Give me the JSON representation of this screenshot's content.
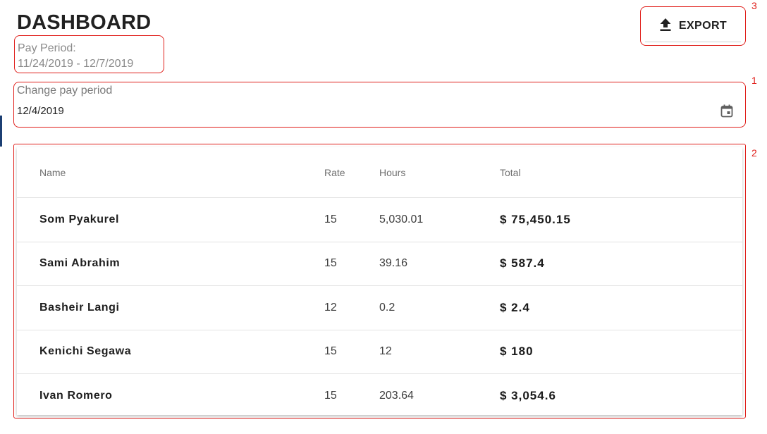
{
  "header": {
    "title": "DASHBOARD",
    "pay_period_label": "Pay Period:",
    "pay_period_range": "11/24/2019 - 12/7/2019",
    "export_label": "EXPORT"
  },
  "date_picker": {
    "label": "Change pay period",
    "value": "12/4/2019"
  },
  "callouts": [
    "1",
    "2",
    "3"
  ],
  "table": {
    "columns": [
      "Name",
      "Rate",
      "Hours",
      "Total"
    ],
    "rows": [
      {
        "name": "Som Pyakurel",
        "rate": "15",
        "hours": "5,030.01",
        "total": "$ 75,450.15"
      },
      {
        "name": "Sami Abrahim",
        "rate": "15",
        "hours": "39.16",
        "total": "$ 587.4"
      },
      {
        "name": "Basheir Langi",
        "rate": "12",
        "hours": "0.2",
        "total": "$ 2.4"
      },
      {
        "name": "Kenichi Segawa",
        "rate": "15",
        "hours": "12",
        "total": "$ 180"
      },
      {
        "name": "Ivan Romero",
        "rate": "15",
        "hours": "203.64",
        "total": "$ 3,054.6"
      }
    ]
  },
  "icons": {
    "export": "upload-icon",
    "calendar": "calendar-icon"
  },
  "colors": {
    "annotation": "#e0201c",
    "accent": "#1c3f73"
  }
}
